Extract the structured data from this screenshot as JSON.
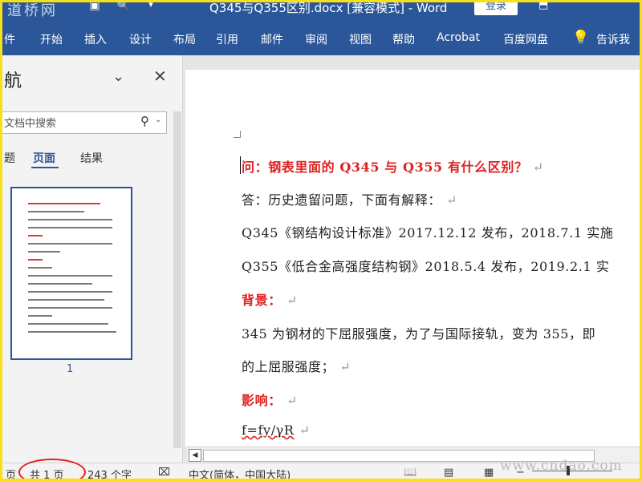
{
  "titlebar": {
    "watermark": "道桥网",
    "title": "Q345与Q355区别.docx [兼容模式] - Word",
    "login": "登录",
    "icons": [
      "save-icon",
      "print-preview-icon",
      "customize-dropdown-icon",
      "ribbon-options-icon"
    ]
  },
  "ribbon": {
    "tabs": [
      "件",
      "开始",
      "插入",
      "设计",
      "布局",
      "引用",
      "邮件",
      "审阅",
      "视图",
      "帮助",
      "Acrobat",
      "百度网盘",
      "告诉我"
    ]
  },
  "nav": {
    "title": "航",
    "search_placeholder": "文档中搜索",
    "tabs": [
      "题",
      "页面",
      "结果"
    ],
    "active_tab": "页面",
    "thumbnail_page_number": "1"
  },
  "doc": {
    "lines": [
      {
        "text": "问：钢表里面的 Q345 与 Q355 有什么区别？",
        "style": "red"
      },
      {
        "text": "答：历史遗留问题，下面有解释：",
        "style": "normal"
      },
      {
        "text": "Q345《钢结构设计标准》2017.12.12 发布，2018.7.1 实施",
        "style": "normal"
      },
      {
        "text": "Q355《低合金高强度结构钢》2018.5.4 发布，2019.2.1 实",
        "style": "normal"
      },
      {
        "text": "背景：",
        "style": "red"
      },
      {
        "text": "345 为钢材的下屈服强度，为了与国际接轨，变为 355，即",
        "style": "normal"
      },
      {
        "text": "的上屈服强度；",
        "style": "normal"
      },
      {
        "text": "影响：",
        "style": "red"
      },
      {
        "text": "f=fy/γR",
        "style": "normal"
      }
    ],
    "paragraph_mark": "↵"
  },
  "status": {
    "page_prefix": "页",
    "pages": "共 1 页",
    "words": "243 个字",
    "language": "中文(简体，中国大陆)",
    "watermark": "www.cndao.com"
  },
  "colors": {
    "ribbon": "#2b579a",
    "heading_red": "#e02020",
    "highlight_oval": "#e02020",
    "frame": "#f5e01a"
  }
}
